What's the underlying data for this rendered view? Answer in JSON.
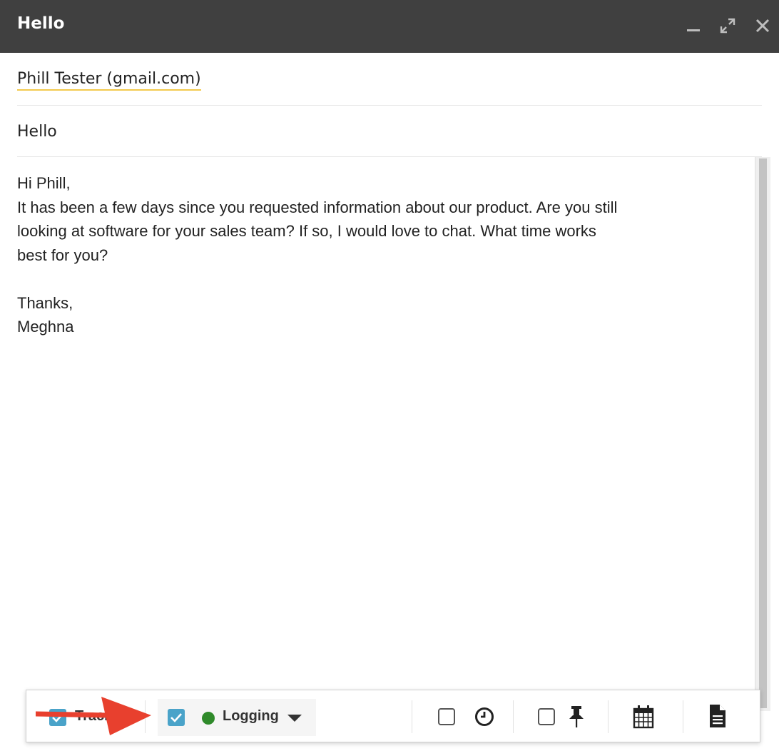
{
  "window": {
    "title": "Hello",
    "controls": [
      "minimize-icon",
      "expand-icon",
      "close-icon"
    ]
  },
  "recipient": "Phill Tester (gmail.com)",
  "subject": "Hello",
  "body": {
    "lines": [
      "Hi Phill,",
      "It has been a few days since you requested information about our product. Are you still",
      "looking at software for your sales team? If so, I would love to chat. What time works",
      "best for you?",
      "",
      "Thanks,",
      "Meghna"
    ]
  },
  "toolbar": {
    "track_label": "Track",
    "track_checked": true,
    "logging_label": "Logging",
    "logging_checked": true,
    "logging_status_color": "#2f8a2a",
    "remind_checked": false,
    "pin_checked": false,
    "icons": [
      "clock-icon",
      "pin-icon",
      "calendar-icon",
      "document-icon"
    ]
  },
  "colors": {
    "titlebar": "#404040",
    "checkbox_checked": "#4aa3c9",
    "recipient_underline": "#f2c94c",
    "annotation_arrow": "#e8402e"
  }
}
